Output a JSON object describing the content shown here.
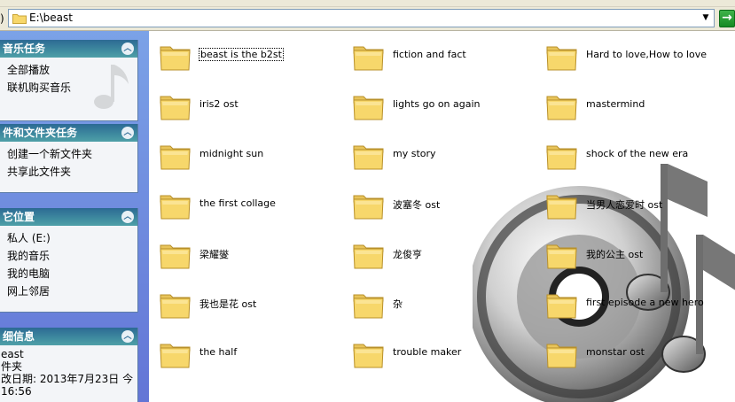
{
  "address": {
    "label": ")",
    "path": "E:\\beast",
    "dropdown_glyph": "▼",
    "go_glyph": "→"
  },
  "sidebar": {
    "music_tasks": {
      "title": "音乐任务",
      "items": [
        "全部播放",
        "联机购买音乐"
      ]
    },
    "folder_tasks": {
      "title": "件和文件夹任务",
      "items": [
        "创建一个新文件夹",
        "共享此文件夹"
      ]
    },
    "other_places": {
      "title": "它位置",
      "items": [
        "私人 (E:)",
        "我的音乐",
        "我的电脑",
        "网上邻居"
      ]
    },
    "details": {
      "title": "细信息",
      "lines": [
        "east",
        "件夹",
        "改日期: 2013年7月23日 今",
        " 16:56"
      ]
    },
    "toggle_glyph": "︿"
  },
  "files": [
    {
      "name": "beast is the b2st",
      "selected": true
    },
    {
      "name": "fiction and fact"
    },
    {
      "name": "Hard to love,How to love"
    },
    {
      "name": "iris2 ost"
    },
    {
      "name": "lights go on again"
    },
    {
      "name": "mastermind"
    },
    {
      "name": "midnight sun"
    },
    {
      "name": "my story"
    },
    {
      "name": "shock of the new era"
    },
    {
      "name": "the first collage"
    },
    {
      "name": "波塞冬 ost"
    },
    {
      "name": "当男人恋爱时 ost"
    },
    {
      "name": "梁耀燮"
    },
    {
      "name": "龙俊亨"
    },
    {
      "name": "我的公主 ost"
    },
    {
      "name": "我也是花 ost"
    },
    {
      "name": "杂"
    },
    {
      "name": "first episode a new hero"
    },
    {
      "name": "the half"
    },
    {
      "name": "trouble maker"
    },
    {
      "name": "monstar ost"
    }
  ],
  "colors": {
    "folder_fill": "#f7d76b",
    "folder_edge": "#c9a437",
    "panel_header": "#2c6a94",
    "go_button": "#1f9a2d"
  }
}
